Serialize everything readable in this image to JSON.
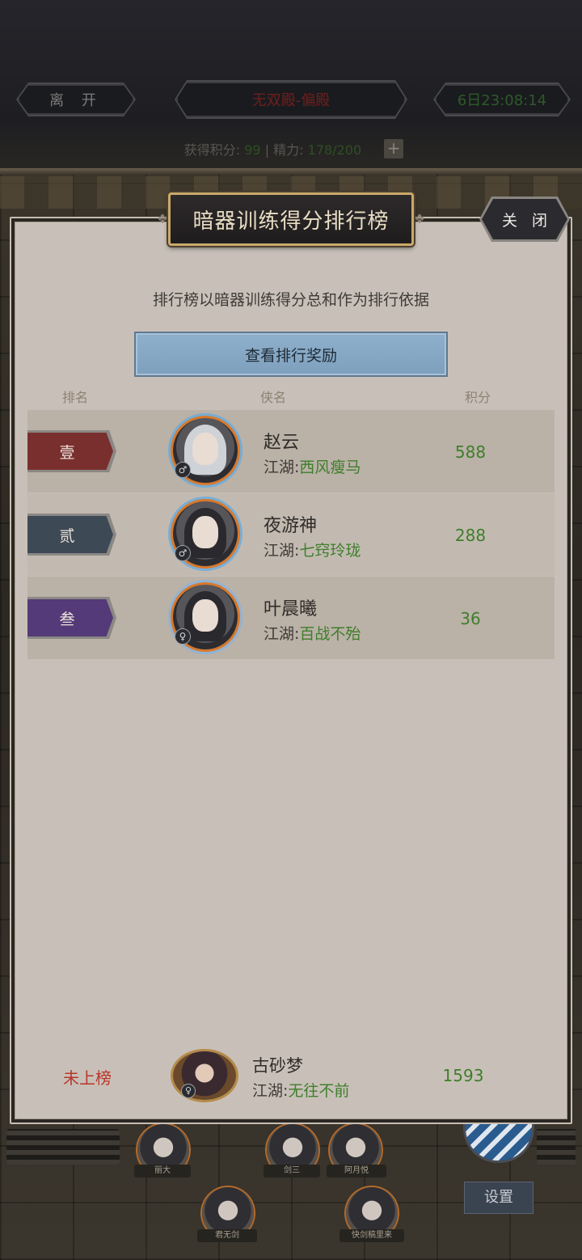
{
  "hud": {
    "leave_label": "离 开",
    "hall_label": "无双殿-偏殿",
    "timer": "6日23:08:14",
    "score_prefix": "获得积分:",
    "score_value": "99",
    "energy_prefix": "| 精力:",
    "energy_value": "178/200",
    "plus_label": "+"
  },
  "dialog": {
    "title": "暗器训练得分排行榜",
    "close_label": "关 闭",
    "description": "排行榜以暗器训练得分总和作为排行依据",
    "reward_button_label": "查看排行奖励",
    "columns": {
      "rank": "排名",
      "name": "侠名",
      "score": "积分"
    },
    "clan_prefix": "江湖:",
    "rows": [
      {
        "rank": "壹",
        "name": "赵云",
        "clan": "西风瘦马",
        "score": "588",
        "gender": "♂",
        "tag_color": "#7a2f2f"
      },
      {
        "rank": "贰",
        "name": "夜游神",
        "clan": "七窍玲珑",
        "score": "288",
        "gender": "♂",
        "tag_color": "#3e4956"
      },
      {
        "rank": "叁",
        "name": "叶晨曦",
        "clan": "百战不殆",
        "score": "36",
        "gender": "♀",
        "tag_color": "#543a78"
      }
    ],
    "self": {
      "status": "未上榜",
      "name": "古砂梦",
      "clan": "无往不前",
      "score": "1593",
      "gender": "♀"
    }
  },
  "background": {
    "characters": [
      "丽大",
      "剑三",
      "阿月悦",
      "君无剑",
      "快剑稿里来"
    ],
    "settings_label": "设置"
  },
  "colors": {
    "accent_green": "#3f7e2b",
    "status_red": "#b8362a",
    "panel_bg": "#c8c0b8",
    "reward_button": "#8fb0cc"
  }
}
